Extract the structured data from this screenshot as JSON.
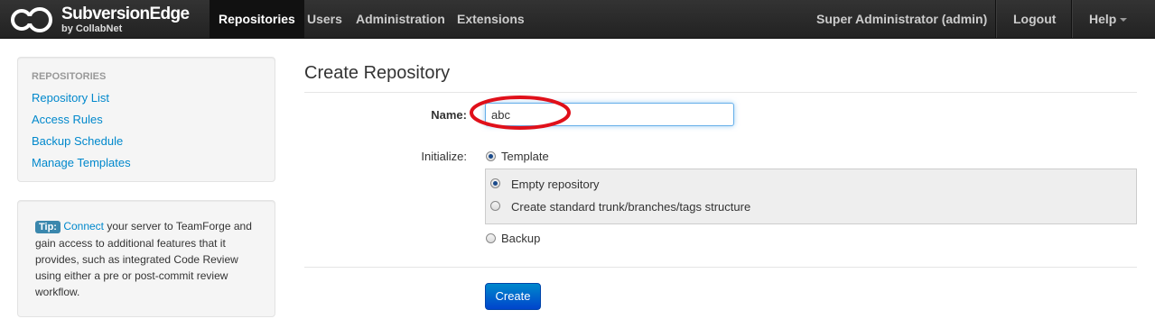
{
  "navbar": {
    "brand_name": "SubversionEdge",
    "brand_sub": "by CollabNet",
    "items": [
      {
        "label": "Repositories",
        "active": true
      },
      {
        "label": "Users"
      },
      {
        "label": "Administration"
      },
      {
        "label": "Extensions"
      }
    ],
    "user": "Super Administrator (admin)",
    "logout": "Logout",
    "help": "Help",
    "icons": [
      "subversionedge-logo",
      "chevron-down-icon"
    ]
  },
  "sidebar": {
    "header": "REPOSITORIES",
    "links": [
      "Repository List",
      "Access Rules",
      "Backup Schedule",
      "Manage Templates"
    ]
  },
  "tip": {
    "badge": "Tip:",
    "link": "Connect",
    "text": " your server to TeamForge and gain access to additional features that it provides, such as integrated Code Review using either a pre or post-commit review workflow."
  },
  "main": {
    "title": "Create Repository",
    "name_label": "Name:",
    "name_value": "abc",
    "initialize_label": "Initialize:",
    "options": {
      "template": {
        "label": "Template",
        "checked": true
      },
      "empty": {
        "label": "Empty repository",
        "checked": true
      },
      "standard": {
        "label": "Create standard trunk/branches/tags structure",
        "checked": false
      },
      "backup": {
        "label": "Backup",
        "checked": false
      }
    },
    "create_button": "Create"
  },
  "colors": {
    "navbar": "#222222",
    "link": "#0088cc",
    "button": "#0055cc",
    "annotation": "#e0101a"
  }
}
